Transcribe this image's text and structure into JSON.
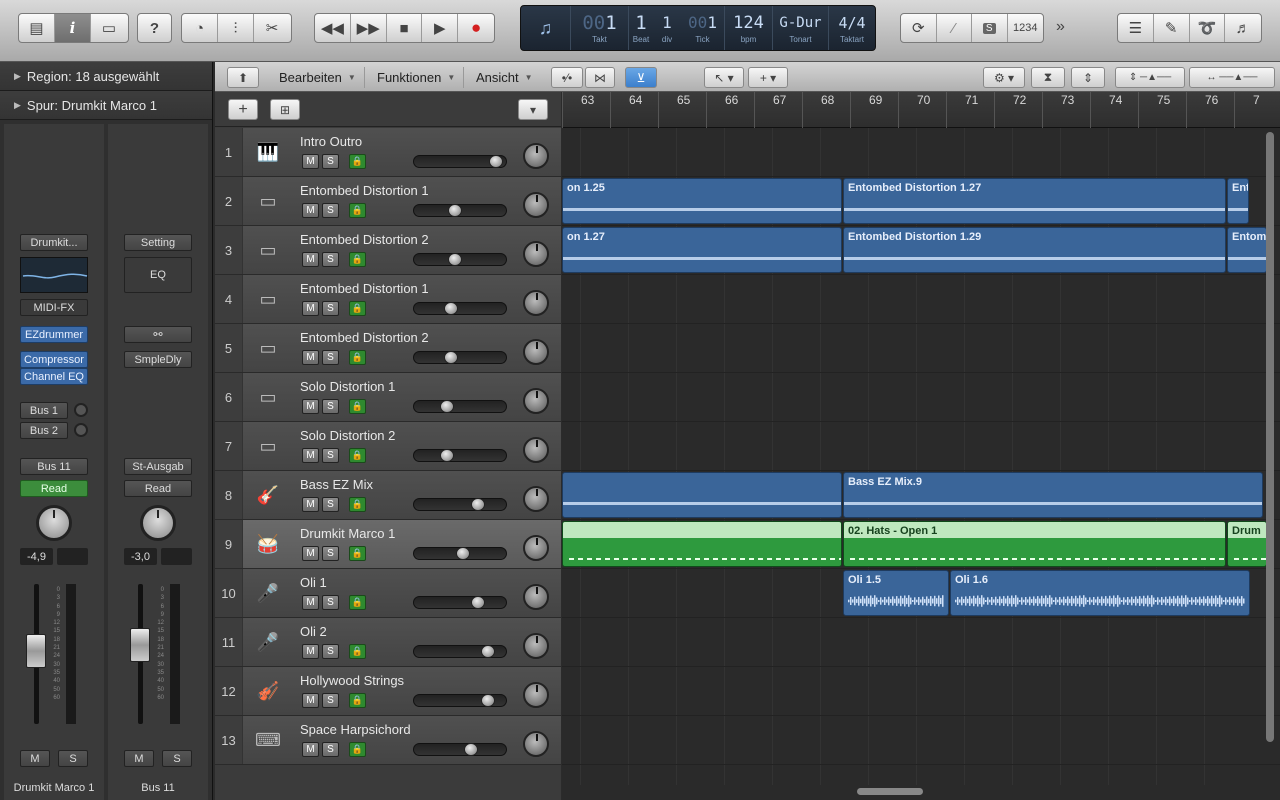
{
  "controlbar": {
    "lcd": {
      "takt": "1",
      "takt_prefix": "00",
      "takt_label": "Takt",
      "beat": "1",
      "beat_label": "Beat",
      "div": "1",
      "div_label": "div",
      "tick": "1",
      "tick_prefix": "00",
      "tick_label": "Tick",
      "bpm": "124",
      "bpm_label": "bpm",
      "key": "G-Dur",
      "key_label": "Tonart",
      "sig_num": "4",
      "sig_den": "4",
      "sig_label": "Taktart"
    },
    "count_in": "1234"
  },
  "inspector": {
    "region_label": "Region:",
    "region_value": "18 ausgewählt",
    "track_label": "Spur:",
    "track_value": "Drumkit Marco 1",
    "strip1": {
      "setting": "Drumkit...",
      "midi_fx": "MIDI-FX",
      "instrument": "EZdrummer",
      "fx1": "Compressor",
      "fx2": "Channel EQ",
      "send1": "Bus 1",
      "send2": "Bus 2",
      "output": "Bus 11",
      "automation": "Read",
      "volume_db": "-4,9",
      "mute": "M",
      "solo": "S",
      "name": "Drumkit Marco 1"
    },
    "strip2": {
      "setting": "Setting",
      "eq": "EQ",
      "fx1": "SmpleDly",
      "output": "St-Ausgab",
      "automation": "Read",
      "volume_db": "-3,0",
      "mute": "M",
      "solo": "S",
      "name": "Bus 11"
    },
    "meter_scale": [
      "0",
      "3",
      "6",
      "9",
      "12",
      "15",
      "18",
      "21",
      "24",
      "30",
      "35",
      "40",
      "50",
      "60"
    ]
  },
  "tracks_menu": {
    "edit": "Bearbeiten",
    "functions": "Funktionen",
    "view": "Ansicht"
  },
  "ruler": [
    "63",
    "64",
    "65",
    "66",
    "67",
    "68",
    "69",
    "70",
    "71",
    "72",
    "73",
    "74",
    "75",
    "76",
    "7"
  ],
  "tracks": [
    {
      "num": "1",
      "name": "Intro Outro",
      "icon": "piano-icon",
      "vol": 0.94
    },
    {
      "num": "2",
      "name": "Entombed Distortion 1",
      "icon": "amp-icon",
      "vol": 0.42
    },
    {
      "num": "3",
      "name": "Entombed Distortion 2",
      "icon": "amp-icon",
      "vol": 0.42
    },
    {
      "num": "4",
      "name": "Entombed Distortion 1",
      "icon": "amp-icon",
      "vol": 0.38
    },
    {
      "num": "5",
      "name": "Entombed Distortion 2",
      "icon": "amp-icon",
      "vol": 0.38
    },
    {
      "num": "6",
      "name": "Solo Distortion 1",
      "icon": "amp-icon",
      "vol": 0.33
    },
    {
      "num": "7",
      "name": "Solo Distortion 2",
      "icon": "amp-icon",
      "vol": 0.33
    },
    {
      "num": "8",
      "name": "Bass EZ Mix",
      "icon": "guitar-icon",
      "vol": 0.71
    },
    {
      "num": "9",
      "name": "Drumkit Marco 1",
      "icon": "drumkit-icon",
      "vol": 0.53
    },
    {
      "num": "10",
      "name": "Oli 1",
      "icon": "microphone-icon",
      "vol": 0.71
    },
    {
      "num": "11",
      "name": "Oli 2",
      "icon": "microphone-icon",
      "vol": 0.84
    },
    {
      "num": "12",
      "name": "Hollywood Strings",
      "icon": "strings-icon",
      "vol": 0.84
    },
    {
      "num": "13",
      "name": "Space Harpsichord",
      "icon": "keyboard-icon",
      "vol": 0.62
    }
  ],
  "track_buttons": {
    "mute": "M",
    "solo": "S"
  },
  "regions": [
    {
      "lane": 1,
      "name": "on 1.25",
      "type": "audio"
    },
    {
      "lane": 1,
      "name": "Entombed Distortion 1.27",
      "type": "audio"
    },
    {
      "lane": 1,
      "name": "Ent",
      "type": "audio"
    },
    {
      "lane": 2,
      "name": "on 1.27",
      "type": "audio"
    },
    {
      "lane": 2,
      "name": "Entombed Distortion 1.29",
      "type": "audio"
    },
    {
      "lane": 2,
      "name": "Entom",
      "type": "audio"
    },
    {
      "lane": 7,
      "name": "",
      "type": "audio"
    },
    {
      "lane": 7,
      "name": "Bass EZ Mix.9",
      "type": "audio"
    },
    {
      "lane": 8,
      "name": "",
      "type": "midi"
    },
    {
      "lane": 8,
      "name": "02. Hats - Open 1",
      "type": "midi"
    },
    {
      "lane": 8,
      "name": "Drum",
      "type": "midi"
    },
    {
      "lane": 9,
      "name": "Oli 1.5",
      "type": "audio"
    },
    {
      "lane": 9,
      "name": "Oli 1.6",
      "type": "audio"
    }
  ],
  "colors": {
    "audio_region": "#3a6599",
    "midi_region": "#2e9a3e",
    "midi_header": "#bfe8bf",
    "selected_track": "#5e5e5e"
  }
}
